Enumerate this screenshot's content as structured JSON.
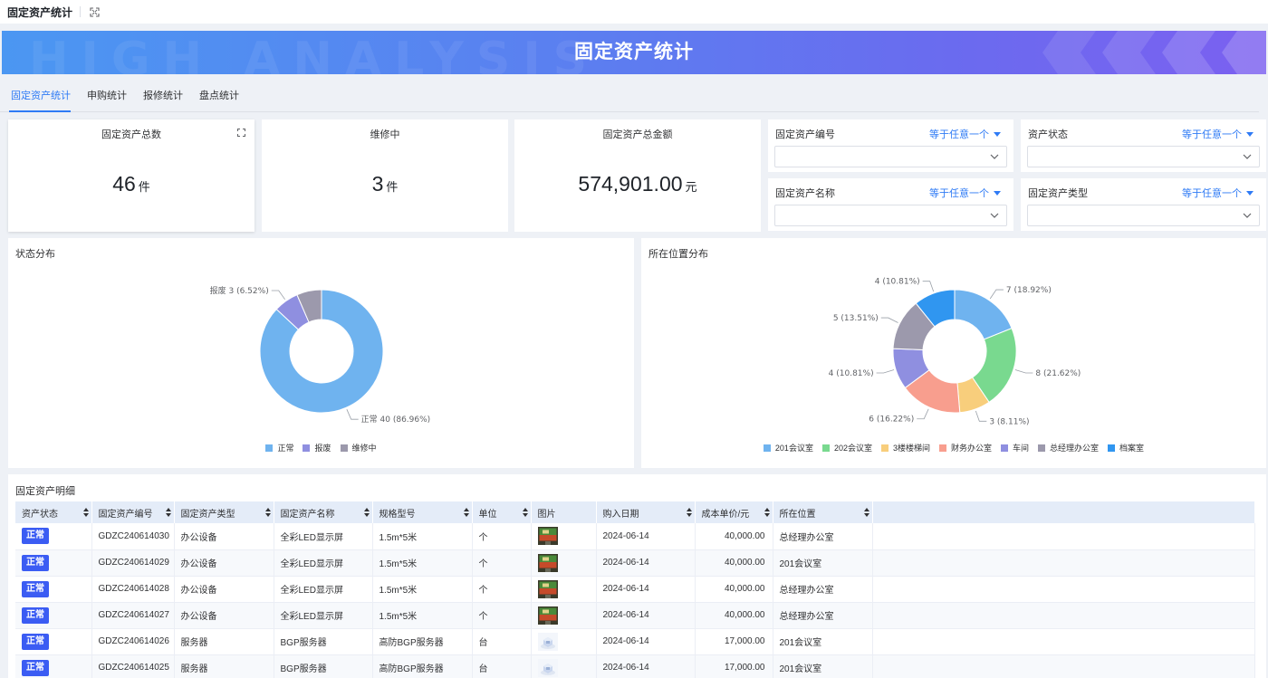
{
  "topbar": {
    "title": "固定资产统计"
  },
  "banner": {
    "title": "固定资产统计",
    "watermark": "HIGH ANALYSIS"
  },
  "tabs": [
    {
      "label": "固定资产统计",
      "active": true
    },
    {
      "label": "申购统计",
      "active": false
    },
    {
      "label": "报修统计",
      "active": false
    },
    {
      "label": "盘点统计",
      "active": false
    }
  ],
  "stats": {
    "total": {
      "label": "固定资产总数",
      "value": "46",
      "unit": "件"
    },
    "repair": {
      "label": "维修中",
      "value": "3",
      "unit": "件"
    },
    "amount": {
      "label": "固定资产总金额",
      "value": "574,901.00",
      "unit": "元"
    }
  },
  "filters": [
    {
      "label": "固定资产编号",
      "operator": "等于任意一个"
    },
    {
      "label": "资产状态",
      "operator": "等于任意一个"
    },
    {
      "label": "固定资产名称",
      "operator": "等于任意一个"
    },
    {
      "label": "固定资产类型",
      "operator": "等于任意一个"
    }
  ],
  "status_chart": {
    "title": "状态分布"
  },
  "location_chart": {
    "title": "所在位置分布"
  },
  "chart_data": [
    {
      "type": "pie",
      "title": "状态分布",
      "donut": true,
      "categories": [
        "正常",
        "报废",
        "维修中"
      ],
      "values": [
        40,
        3,
        3
      ],
      "colors": [
        "#6fb3ef",
        "#8f8fe0",
        "#9c99ac"
      ],
      "data_labels": [
        "正常 40 (86.96%)",
        "报废 3 (6.52%)"
      ],
      "legend": "bottom"
    },
    {
      "type": "pie",
      "title": "所在位置分布",
      "donut": true,
      "categories": [
        "201会议室",
        "202会议室",
        "3楼楼梯间",
        "财务办公室",
        "车间",
        "总经理办公室",
        "档案室"
      ],
      "values": [
        7,
        8,
        3,
        6,
        4,
        5,
        4
      ],
      "colors": [
        "#6fb3ef",
        "#79d98f",
        "#f8ce7c",
        "#f89e8e",
        "#8f8fe0",
        "#9c99ac",
        "#3096f0"
      ],
      "data_labels": [
        "7 (18.92%)",
        "8 (21.62%)",
        "3 (8.11%)",
        "6 (16.22%)",
        "4 (10.81%)",
        "5 (13.51%)",
        "4 (10.81%)"
      ],
      "legend": "bottom"
    }
  ],
  "table": {
    "title": "固定资产明细",
    "columns": [
      "资产状态",
      "固定资产编号",
      "固定资产类型",
      "固定资产名称",
      "规格型号",
      "单位",
      "图片",
      "购入日期",
      "成本单价/元",
      "所在位置"
    ],
    "rows": [
      {
        "status": "正常",
        "code": "GDZC240614030",
        "type": "办公设备",
        "name": "全彩LED显示屏",
        "spec": "1.5m*5米",
        "unit": "个",
        "image": "led-screen",
        "date": "2024-06-14",
        "price": "40,000.00",
        "location": "总经理办公室"
      },
      {
        "status": "正常",
        "code": "GDZC240614029",
        "type": "办公设备",
        "name": "全彩LED显示屏",
        "spec": "1.5m*5米",
        "unit": "个",
        "image": "led-screen",
        "date": "2024-06-14",
        "price": "40,000.00",
        "location": "201会议室"
      },
      {
        "status": "正常",
        "code": "GDZC240614028",
        "type": "办公设备",
        "name": "全彩LED显示屏",
        "spec": "1.5m*5米",
        "unit": "个",
        "image": "led-screen",
        "date": "2024-06-14",
        "price": "40,000.00",
        "location": "总经理办公室"
      },
      {
        "status": "正常",
        "code": "GDZC240614027",
        "type": "办公设备",
        "name": "全彩LED显示屏",
        "spec": "1.5m*5米",
        "unit": "个",
        "image": "led-screen",
        "date": "2024-06-14",
        "price": "40,000.00",
        "location": "总经理办公室"
      },
      {
        "status": "正常",
        "code": "GDZC240614026",
        "type": "服务器",
        "name": "BGP服务器",
        "spec": "高防BGP服务器",
        "unit": "台",
        "image": "server",
        "date": "2024-06-14",
        "price": "17,000.00",
        "location": "201会议室"
      },
      {
        "status": "正常",
        "code": "GDZC240614025",
        "type": "服务器",
        "name": "BGP服务器",
        "spec": "高防BGP服务器",
        "unit": "台",
        "image": "server",
        "date": "2024-06-14",
        "price": "17,000.00",
        "location": "201会议室"
      }
    ]
  },
  "colors": {
    "accent": "#2f7bf5",
    "badge": "#3b5cf3",
    "header_bg": "#e4ecf8"
  }
}
